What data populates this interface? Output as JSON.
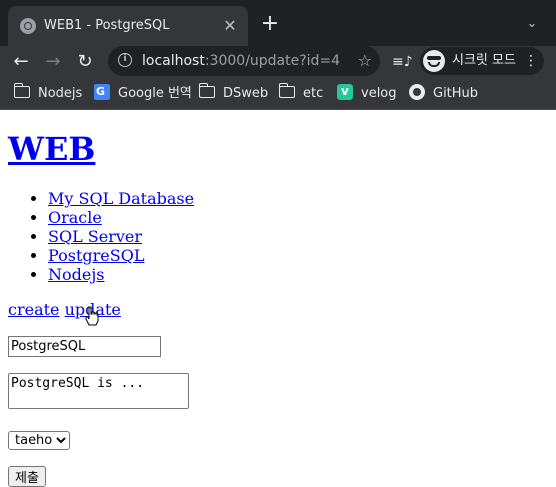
{
  "browser": {
    "tab_title": "WEB1 - PostgreSQL",
    "tab_close": "✕",
    "new_tab": "+",
    "tab_search": "⌄",
    "url_host": "localhost",
    "url_path": ":3000/update?id=4",
    "back": "←",
    "forward": "→",
    "reload": "↻",
    "star": "☆",
    "playlist": "≡♪",
    "profile_label": "시크릿 모드",
    "menu": "⋮",
    "icons": {
      "tab_favicon": "globe-icon",
      "site_info": "info-icon",
      "bookmark_star": "star-icon",
      "reading_list": "playlist-icon",
      "incognito": "incognito-icon"
    }
  },
  "bookmarks": [
    {
      "label": "Nodejs",
      "icon": "folder-icon"
    },
    {
      "label": "Google 번역",
      "icon": "google-translate-icon"
    },
    {
      "label": "DSweb",
      "icon": "folder-icon"
    },
    {
      "label": "etc",
      "icon": "folder-icon"
    },
    {
      "label": "velog",
      "icon": "velog-icon"
    },
    {
      "label": "GitHub",
      "icon": "github-icon"
    }
  ],
  "page": {
    "title": "WEB",
    "nav": [
      "My SQL Database",
      "Oracle",
      "SQL Server",
      "PostgreSQL",
      "Nodejs"
    ],
    "actions": {
      "create": "create",
      "update": "update"
    },
    "form": {
      "title_value": "PostgreSQL",
      "description_value": "PostgreSQL is ...",
      "author_selected": "taeho",
      "submit_label": "제출"
    }
  },
  "colors": {
    "tabbar_bg": "#202124",
    "toolbar_bg": "#35363a",
    "link": "#0000ee"
  }
}
